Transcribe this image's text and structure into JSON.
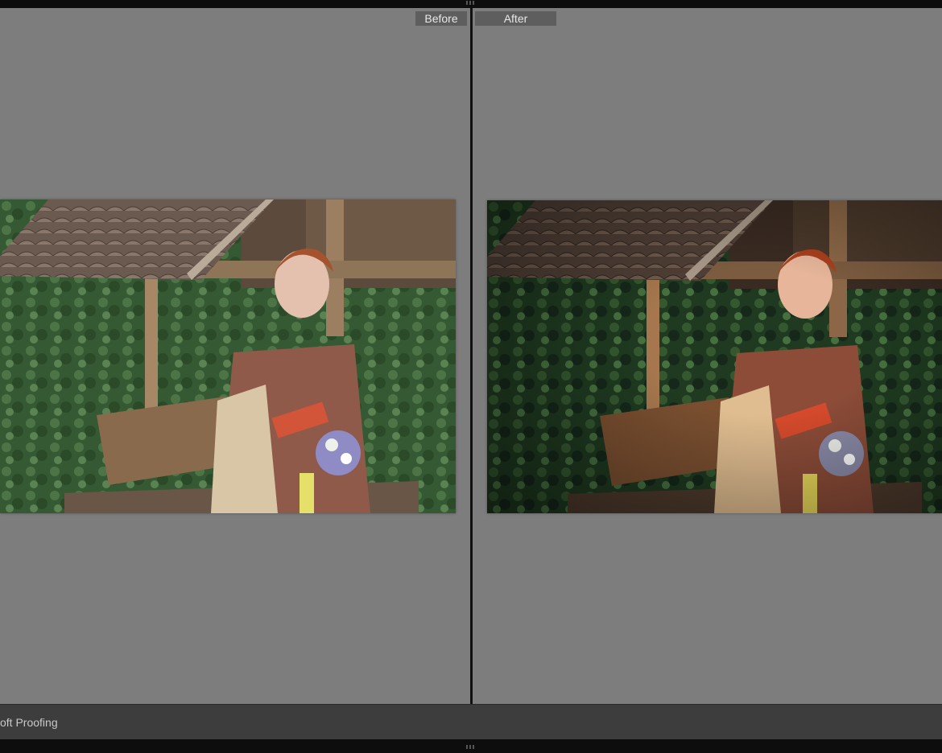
{
  "compare": {
    "before_label": "Before",
    "after_label": "After"
  },
  "toolbar": {
    "soft_proofing_label": "oft Proofing"
  },
  "photo": {
    "description_icon": "portrait-photo"
  }
}
